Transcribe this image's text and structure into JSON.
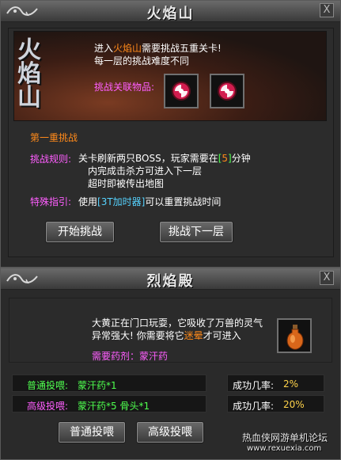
{
  "panel_top": {
    "title": "火焰山",
    "close_label": "X",
    "banner_title": "火焰山",
    "desc_prefix": "进入",
    "desc_place": "火焰山",
    "desc_suffix": "需要挑战五重关卡!",
    "desc_line2": "每一层的挑战难度不同",
    "related_items_label": "挑战关联物品:",
    "section_title": "第一重挑战",
    "rule_label": "挑战规则:",
    "rule_line1_a": "关卡刷新两只BOSS，玩家需要在",
    "rule_line1_bracket_open": "[",
    "rule_line1_num": "5",
    "rule_line1_bracket_close": "]",
    "rule_line1_b": "分钟",
    "rule_line2": "内完成击杀方可进入下一层",
    "rule_line3": "超时即被传出地图",
    "special_label": "特殊指引:",
    "special_prefix": "使用",
    "special_item": "[3T加时器]",
    "special_suffix": "可以重置挑战时间",
    "btn_start": "开始挑战",
    "btn_next": "挑战下一层"
  },
  "panel_bottom": {
    "title": "烈焰殿",
    "close_label": "X",
    "dialog_line1": "大黄正在门口玩耍，它吸收了万兽的灵气",
    "dialog_line2_a": "异常强大! 你需要将它",
    "dialog_line2_highlight": "迷晕",
    "dialog_line2_b": "才可进入",
    "required_label": "需要药剂：蒙汗药",
    "normal_feed_label": "普通投喂:",
    "normal_feed_value": "蒙汗药*1",
    "normal_rate_label": "成功几率:",
    "normal_rate_value": "2%",
    "advanced_feed_label": "高级投喂:",
    "advanced_feed_value": "蒙汗药*5 骨头*1",
    "advanced_rate_label": "成功几率:",
    "advanced_rate_value": "20%",
    "btn_normal": "普通投喂",
    "btn_advanced": "高级投喂"
  },
  "watermark": {
    "cn": "热血侠网游单机论坛",
    "url": "www.rexuexia.com"
  },
  "colors": {
    "accent_orange": "#ff8a1a",
    "accent_purple": "#ff5eff",
    "accent_cyan": "#56d3ff",
    "accent_green": "#4fff4f",
    "accent_yellow": "#ffd34a"
  },
  "icons": [
    "dragon-emblem-icon",
    "close-icon",
    "rune-item-icon",
    "potion-icon"
  ]
}
